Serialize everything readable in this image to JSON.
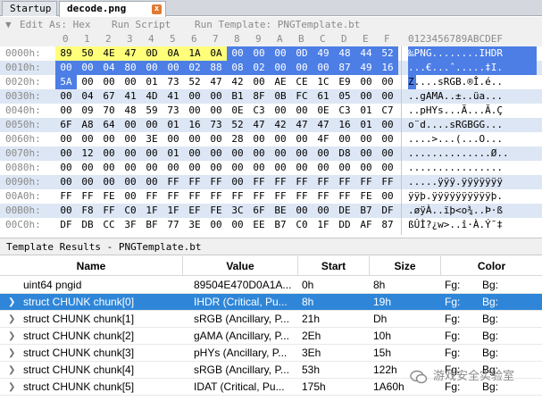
{
  "tabs": [
    {
      "label": "Startup"
    },
    {
      "label": "decode.png",
      "close": "x"
    }
  ],
  "toolbar": {
    "edit_as": "Edit As: Hex",
    "run_script": "Run Script",
    "run_template": "Run Template: PNGTemplate.bt"
  },
  "hex_header": [
    "0",
    "1",
    "2",
    "3",
    "4",
    "5",
    "6",
    "7",
    "8",
    "9",
    "A",
    "B",
    "C",
    "D",
    "E",
    "F"
  ],
  "ascii_header": "0123456789ABCDEF",
  "hex_rows": [
    {
      "addr": "0000h:",
      "bytes": [
        "89",
        "50",
        "4E",
        "47",
        "0D",
        "0A",
        "1A",
        "0A",
        "00",
        "00",
        "00",
        "0D",
        "49",
        "48",
        "44",
        "52"
      ],
      "ascii": "‰PNG........IHDR"
    },
    {
      "addr": "0010h:",
      "bytes": [
        "00",
        "00",
        "04",
        "80",
        "00",
        "00",
        "02",
        "88",
        "08",
        "02",
        "00",
        "00",
        "00",
        "87",
        "49",
        "16"
      ],
      "ascii": "...€...ˆ.....‡I."
    },
    {
      "addr": "0020h:",
      "bytes": [
        "5A",
        "00",
        "00",
        "00",
        "01",
        "73",
        "52",
        "47",
        "42",
        "00",
        "AE",
        "CE",
        "1C",
        "E9",
        "00",
        "00"
      ],
      "ascii": "Z....sRGB.®Î.é.."
    },
    {
      "addr": "0030h:",
      "bytes": [
        "00",
        "04",
        "67",
        "41",
        "4D",
        "41",
        "00",
        "00",
        "B1",
        "8F",
        "0B",
        "FC",
        "61",
        "05",
        "00",
        "00"
      ],
      "ascii": "..gAMA..±..üa..."
    },
    {
      "addr": "0040h:",
      "bytes": [
        "00",
        "09",
        "70",
        "48",
        "59",
        "73",
        "00",
        "00",
        "0E",
        "C3",
        "00",
        "00",
        "0E",
        "C3",
        "01",
        "C7"
      ],
      "ascii": "..pHYs...Ã...Ã.Ç"
    },
    {
      "addr": "0050h:",
      "bytes": [
        "6F",
        "A8",
        "64",
        "00",
        "00",
        "01",
        "16",
        "73",
        "52",
        "47",
        "42",
        "47",
        "47",
        "16",
        "01",
        "00"
      ],
      "ascii": "o¨d....sRGBGG..."
    },
    {
      "addr": "0060h:",
      "bytes": [
        "00",
        "00",
        "00",
        "00",
        "3E",
        "00",
        "00",
        "00",
        "28",
        "00",
        "00",
        "00",
        "4F",
        "00",
        "00",
        "00"
      ],
      "ascii": "....>...(...O..."
    },
    {
      "addr": "0070h:",
      "bytes": [
        "00",
        "12",
        "00",
        "00",
        "00",
        "01",
        "00",
        "00",
        "00",
        "00",
        "00",
        "00",
        "00",
        "D8",
        "00",
        "00"
      ],
      "ascii": "..............Ø.."
    },
    {
      "addr": "0080h:",
      "bytes": [
        "00",
        "00",
        "00",
        "00",
        "00",
        "00",
        "00",
        "00",
        "00",
        "00",
        "00",
        "00",
        "00",
        "00",
        "00",
        "00"
      ],
      "ascii": "................"
    },
    {
      "addr": "0090h:",
      "bytes": [
        "00",
        "00",
        "00",
        "00",
        "00",
        "FF",
        "FF",
        "FF",
        "00",
        "FF",
        "FF",
        "FF",
        "FF",
        "FF",
        "FF",
        "FF"
      ],
      "ascii": ".....ÿÿÿ.ÿÿÿÿÿÿÿ"
    },
    {
      "addr": "00A0h:",
      "bytes": [
        "FF",
        "FF",
        "FE",
        "00",
        "FF",
        "FF",
        "FF",
        "FF",
        "FF",
        "FF",
        "FF",
        "FF",
        "FF",
        "FF",
        "FE",
        "00"
      ],
      "ascii": "ÿÿþ.ÿÿÿÿÿÿÿÿÿÿþ."
    },
    {
      "addr": "00B0h:",
      "bytes": [
        "00",
        "F8",
        "FF",
        "C0",
        "1F",
        "1F",
        "EF",
        "FE",
        "3C",
        "6F",
        "BE",
        "00",
        "00",
        "DE",
        "B7",
        "DF"
      ],
      "ascii": ".øÿÀ..ïþ<o¾..Þ·ß"
    },
    {
      "addr": "00C0h:",
      "bytes": [
        "DF",
        "DB",
        "CC",
        "3F",
        "BF",
        "77",
        "3E",
        "00",
        "00",
        "EE",
        "B7",
        "C0",
        "1F",
        "DD",
        "AF",
        "87"
      ],
      "ascii": "ßÛÌ?¿w>..î·À.Ý¯‡"
    }
  ],
  "highlight": {
    "yellow_bytes": 8,
    "blue_bytes": 25
  },
  "template_results_title": "Template Results - PNGTemplate.bt",
  "table": {
    "headers": [
      "Name",
      "Value",
      "Start",
      "Size",
      "Color"
    ],
    "rows": [
      {
        "name": "uint64 pngid",
        "value": "89504E470D0A1A...",
        "start": "0h",
        "size": "8h",
        "fg": "Fg:",
        "bg": "Bg:",
        "expandable": false,
        "selected": false
      },
      {
        "name": "struct CHUNK chunk[0]",
        "value": "IHDR  (Critical, Pu...",
        "start": "8h",
        "size": "19h",
        "fg": "Fg:",
        "bg": "Bg:",
        "expandable": true,
        "selected": true
      },
      {
        "name": "struct CHUNK chunk[1]",
        "value": "sRGB  (Ancillary, P...",
        "start": "21h",
        "size": "Dh",
        "fg": "Fg:",
        "bg": "Bg:",
        "expandable": true,
        "selected": false
      },
      {
        "name": "struct CHUNK chunk[2]",
        "value": "gAMA  (Ancillary, P...",
        "start": "2Eh",
        "size": "10h",
        "fg": "Fg:",
        "bg": "Bg:",
        "expandable": true,
        "selected": false
      },
      {
        "name": "struct CHUNK chunk[3]",
        "value": "pHYs  (Ancillary, P...",
        "start": "3Eh",
        "size": "15h",
        "fg": "Fg:",
        "bg": "Bg:",
        "expandable": true,
        "selected": false
      },
      {
        "name": "struct CHUNK chunk[4]",
        "value": "sRGB  (Ancillary, P...",
        "start": "53h",
        "size": "122h",
        "fg": "Fg:",
        "bg": "Bg:",
        "expandable": true,
        "selected": false
      },
      {
        "name": "struct CHUNK chunk[5]",
        "value": "IDAT  (Critical, Pu...",
        "start": "175h",
        "size": "1A60h",
        "fg": "Fg:",
        "bg": "Bg:",
        "expandable": true,
        "selected": false
      }
    ]
  },
  "watermark": "游戏安全实验室",
  "colors": {
    "yellow": "#ffff7a",
    "blue": "#4d7ee6",
    "selection": "#2f86d8",
    "stripe": "#dde6f4",
    "addr_head": "#8a8a8a"
  }
}
